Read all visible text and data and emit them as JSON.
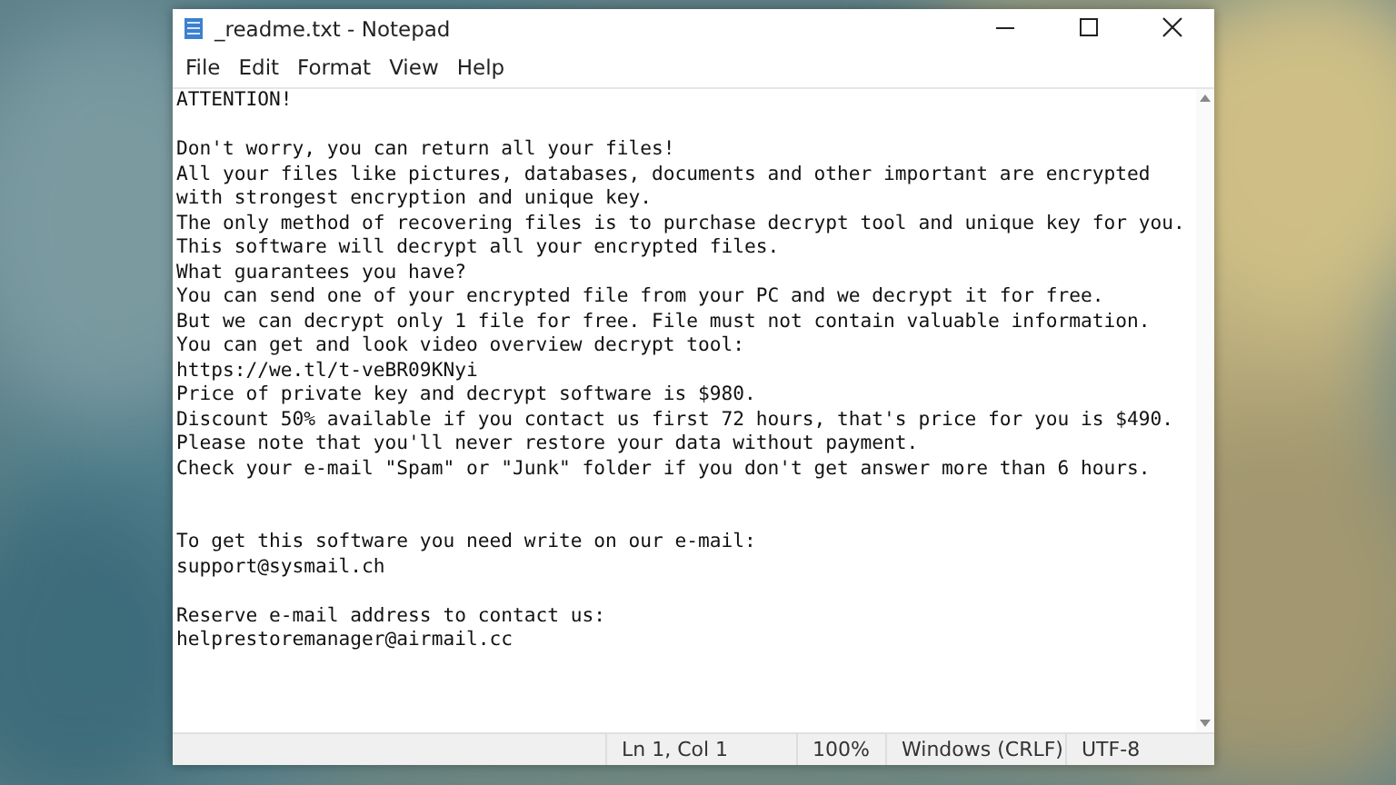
{
  "window": {
    "title": "_readme.txt - Notepad"
  },
  "menu": [
    "File",
    "Edit",
    "Format",
    "View",
    "Help"
  ],
  "document": {
    "paragraphs": [
      {
        "kind": "heading",
        "lines": [
          "ATTENTION!"
        ]
      },
      {
        "kind": "paragraph",
        "lines": [
          "Don't worry, you can return all your files!",
          "All your files like pictures, databases, documents and other important are encrypted",
          "with strongest encryption and unique key.",
          "The only method of recovering files is to purchase decrypt tool and unique key for you.",
          "This software will decrypt all your encrypted files.",
          "What guarantees you have?",
          "You can send one of your encrypted file from your PC and we decrypt it for free.",
          "But we can decrypt only 1 file for free. File must not contain valuable information.",
          "You can get and look video overview decrypt tool:",
          "https://we.tl/t-veBR09KNyi",
          "Price of private key and decrypt software is $980.",
          "Discount 50% available if you contact us first 72 hours, that's price for you is $490.",
          "Please note that you'll never restore your data without payment.",
          "Check your e-mail \"Spam\" or \"Junk\" folder if you don't get answer more than 6 hours."
        ]
      },
      {
        "kind": "section",
        "lines": [
          "To get this software you need write on our e-mail:",
          "support@sysmail.ch"
        ]
      },
      {
        "kind": "paragraph",
        "lines": [
          "Reserve e-mail address to contact us:",
          "helprestoremanager@airmail.cc"
        ]
      }
    ]
  },
  "status_bar": [
    "Ln 1, Col 1",
    "100%",
    "Windows (CRLF)",
    "UTF-8"
  ]
}
